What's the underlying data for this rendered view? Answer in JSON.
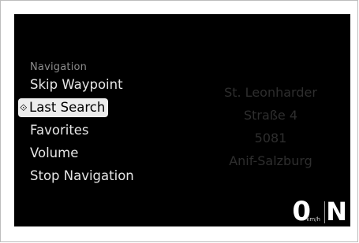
{
  "menu": {
    "title": "Navigation",
    "selected_marker": "⟐",
    "items": [
      {
        "label": "Skip Waypoint"
      },
      {
        "label": "Last Search"
      },
      {
        "label": "Favorites"
      },
      {
        "label": "Volume"
      },
      {
        "label": "Stop Navigation"
      }
    ],
    "selected_index": 1
  },
  "destination": {
    "lines": [
      "St. Leonharder",
      "Straße 4",
      "5081",
      "Anif-Salzburg"
    ]
  },
  "status": {
    "speed": "0",
    "speed_unit": "km/h",
    "gear": "N"
  },
  "colors": {
    "screen_bg": "#000000",
    "selection_bg": "#ededed",
    "address_text": "#2e2e2e",
    "menu_text": "#e6e6e6"
  }
}
